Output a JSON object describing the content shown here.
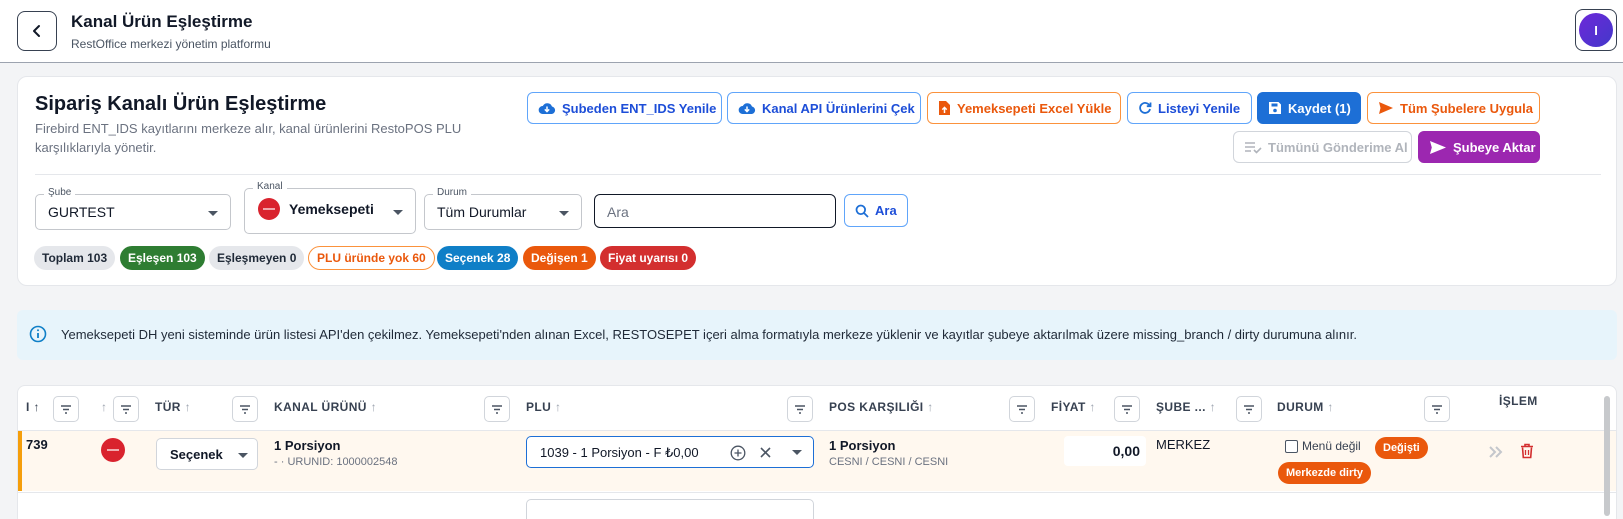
{
  "header": {
    "title": "Kanal Ürün Eşleştirme",
    "subtitle": "RestOffice merkezi yönetim platformu",
    "avatar_initial": "I"
  },
  "page": {
    "title": "Sipariş Kanalı Ürün Eşleştirme",
    "description": "Firebird ENT_IDS kayıtlarını merkeze alır, kanal ürünlerini RestoPOS PLU karşılıklarıyla yönetir."
  },
  "actions": {
    "refresh_ent_ids": "Şubeden ENT_IDS Yenile",
    "fetch_api": "Kanal API Ürünlerini Çek",
    "excel_upload": "Yemeksepeti Excel Yükle",
    "refresh_list": "Listeyi Yenile",
    "save": "Kaydet (1)",
    "apply_all": "Tüm Şubelere Uygula",
    "exclude_all": "Tümünü Gönderime Al",
    "transfer": "Şubeye Aktar"
  },
  "filters": {
    "branch_label": "Şube",
    "branch_value": "GURTEST",
    "channel_label": "Kanal",
    "channel_value": "Yemeksepeti",
    "status_label": "Durum",
    "status_value": "Tüm Durumlar",
    "search_placeholder": "Ara",
    "search_button": "Ara"
  },
  "chips": {
    "total": "Toplam 103",
    "matched": "Eşleşen 103",
    "unmatched": "Eşleşmeyen 0",
    "plu_missing": "PLU üründe yok 60",
    "option": "Seçenek 28",
    "changed": "Değişen 1",
    "price_warn": "Fiyat uyarısı 0"
  },
  "info": {
    "text": "Yemeksepeti DH yeni sisteminde ürün listesi API'den çekilmez. Yemeksepeti'nden alınan Excel, RESTOSEPET içeri alma formatıyla merkeze yüklenir ve kayıtlar şubeye aktarılmak üzere missing_branch / dirty durumuna alınır."
  },
  "table": {
    "columns": {
      "id": "I",
      "type": "TÜR",
      "channel_product": "KANAL ÜRÜNÜ",
      "plu": "PLU",
      "pos_match": "POS KARŞILIĞI",
      "price": "FİYAT",
      "branch": "ŞUBE ...",
      "status": "DURUM",
      "action": "İŞLEM"
    },
    "rows": [
      {
        "id": "739",
        "type": "Seçenek",
        "product_name": "1 Porsiyon",
        "product_meta": "- · URUNID: 1000002548",
        "plu_value": "1039 - 1 Porsiyon - F ₺0,00",
        "pos_name": "1 Porsiyon",
        "pos_path": "CESNI / CESNI / CESNI",
        "price": "0,00",
        "branch": "MERKEZ",
        "menu_flag": "Menü değil",
        "status_changed": "Değişti",
        "status_dirty": "Merkezde dirty"
      }
    ]
  },
  "colors": {
    "primary": "#1d6fd6",
    "orange": "#ea580c",
    "purple": "#9c27b0",
    "green": "#2e7d32",
    "red": "#d32f2f",
    "info_bg": "#e7f4fb"
  }
}
